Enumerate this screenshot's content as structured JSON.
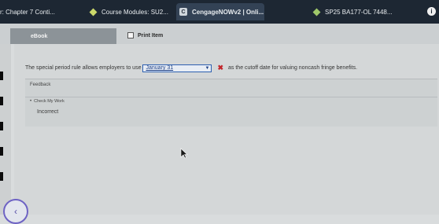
{
  "browser": {
    "tabs": [
      {
        "label": "r: Chapter 7 Conti...",
        "icon": "none"
      },
      {
        "label": "Course Modules: SU2...",
        "icon": "diamond-icon"
      },
      {
        "label": "CengageNOWv2 | Onli...",
        "icon": "c-icon"
      },
      {
        "label": "SP25 BA177-OL 7448...",
        "icon": "diamond-icon"
      }
    ],
    "info_glyph": "i"
  },
  "toolbar": {
    "ebook_label": "eBook",
    "print_label": "Print Item"
  },
  "question": {
    "text_before": "The special period rule allows employers to use",
    "selected_answer": "January 31",
    "text_after": "as the cutoff date for valuing noncash fringe benefits.",
    "status_mark": "✖"
  },
  "feedback": {
    "heading": "Feedback",
    "check_label": "Check My Work",
    "result": "Incorrect"
  },
  "nav": {
    "back_glyph": "‹"
  }
}
